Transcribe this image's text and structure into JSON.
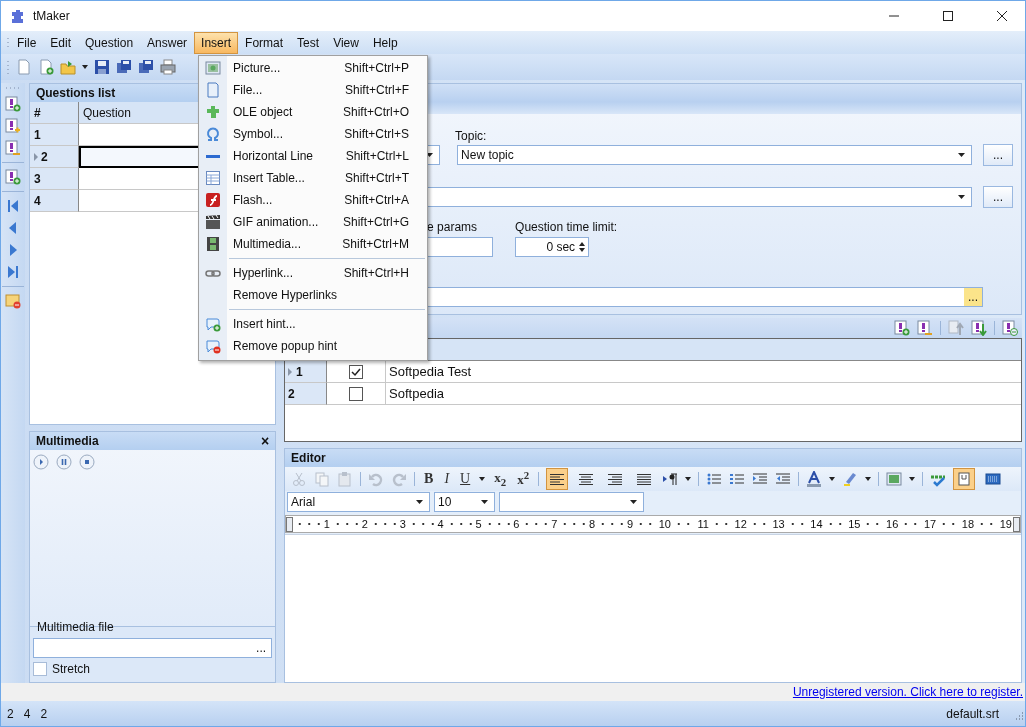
{
  "window": {
    "title": "tMaker"
  },
  "menu_bar": [
    {
      "label": "File",
      "selected": false
    },
    {
      "label": "Edit",
      "selected": false
    },
    {
      "label": "Question",
      "selected": false
    },
    {
      "label": "Answer",
      "selected": false
    },
    {
      "label": "Insert",
      "selected": true
    },
    {
      "label": "Format",
      "selected": false
    },
    {
      "label": "Test",
      "selected": false
    },
    {
      "label": "View",
      "selected": false
    },
    {
      "label": "Help",
      "selected": false
    }
  ],
  "insert_menu": [
    {
      "kind": "item",
      "label": "Picture...",
      "shortcut": "Shift+Ctrl+P"
    },
    {
      "kind": "item",
      "label": "File...",
      "shortcut": "Shift+Ctrl+F"
    },
    {
      "kind": "item",
      "label": "OLE object",
      "shortcut": "Shift+Ctrl+O"
    },
    {
      "kind": "item",
      "label": "Symbol...",
      "shortcut": "Shift+Ctrl+S"
    },
    {
      "kind": "item",
      "label": "Horizontal Line",
      "shortcut": "Shift+Ctrl+L"
    },
    {
      "kind": "item",
      "label": "Insert Table...",
      "shortcut": "Shift+Ctrl+T"
    },
    {
      "kind": "item",
      "label": "Flash...",
      "shortcut": "Shift+Ctrl+A"
    },
    {
      "kind": "item",
      "label": "GIF animation...",
      "shortcut": "Shift+Ctrl+G"
    },
    {
      "kind": "item",
      "label": "Multimedia...",
      "shortcut": "Shift+Ctrl+M"
    },
    {
      "kind": "separator"
    },
    {
      "kind": "item",
      "label": "Hyperlink...",
      "shortcut": "Shift+Ctrl+H"
    },
    {
      "kind": "item",
      "label": "Remove Hyperlinks"
    },
    {
      "kind": "separator"
    },
    {
      "kind": "item",
      "label": "Insert hint..."
    },
    {
      "kind": "item",
      "label": "Remove popup hint"
    }
  ],
  "questions_list": {
    "title": "Questions list",
    "columns": [
      "#",
      "Question"
    ],
    "rows": [
      {
        "number": "1",
        "selected": false
      },
      {
        "number": "2",
        "selected": true
      },
      {
        "number": "3",
        "selected": false
      },
      {
        "number": "4",
        "selected": false
      }
    ]
  },
  "multimedia": {
    "title": "Multimedia",
    "close": "×",
    "file_label": "Multimedia file",
    "browse": "...",
    "stretch": {
      "label": "Stretch",
      "checked": false
    }
  },
  "question_form": {
    "topic_label": "Topic:",
    "topic": "New topic",
    "browse": "...",
    "params_label": "e params",
    "time_limit_label": "Question time limit:",
    "time_limit": "0 sec",
    "file_browse": "..."
  },
  "answers": {
    "rows": [
      {
        "number": "1",
        "selected": true,
        "correct": true,
        "text": "Softpedia Test"
      },
      {
        "number": "2",
        "selected": false,
        "correct": false,
        "text": "Softpedia"
      }
    ]
  },
  "editor": {
    "title": "Editor",
    "edit_enabled": false,
    "text_buttons": [
      "B",
      "I",
      "U",
      "x$_{2}$",
      "x$^{2}$"
    ],
    "alignment": [
      {
        "selected": true
      },
      {
        "selected": false
      },
      {
        "selected": false
      },
      {
        "selected": false
      }
    ],
    "design_mode": true,
    "html_mode": false,
    "font": "Arial",
    "size": "10",
    "ruler": [
      "1",
      "2",
      "3",
      "4",
      "5",
      "6",
      "7",
      "8",
      "9",
      "10",
      "11",
      "12",
      "13",
      "14",
      "15",
      "16",
      "17",
      "18",
      "19"
    ]
  },
  "register_link": "Unregistered version. Click here to register.",
  "status_bar": {
    "counts": [
      "2",
      "4",
      "2"
    ],
    "file": "default.srt"
  }
}
